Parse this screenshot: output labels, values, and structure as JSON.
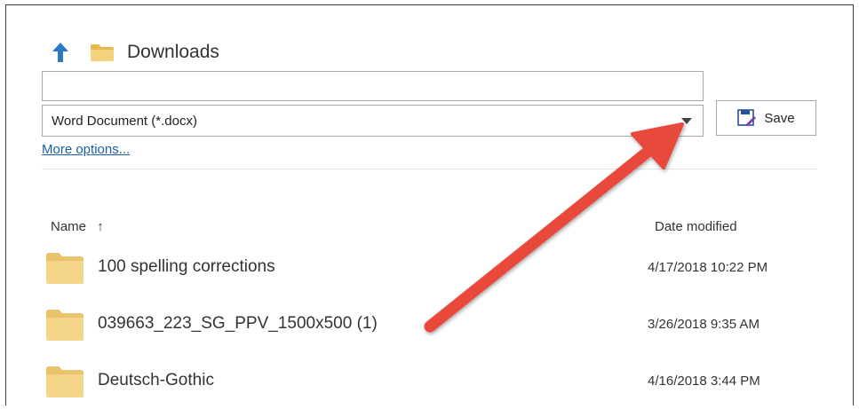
{
  "location": {
    "folder_name": "Downloads",
    "up_icon": "arrow-up-icon",
    "folder_icon": "folder-icon"
  },
  "filename": {
    "value": "",
    "placeholder": ""
  },
  "filetype": {
    "selected": "Word Document (*.docx)"
  },
  "actions": {
    "save_label": "Save",
    "more_options_label": "More options..."
  },
  "columns": {
    "name": "Name",
    "sort_icon": "↑",
    "date_modified": "Date modified"
  },
  "files": [
    {
      "name": "100 spelling corrections",
      "date": "4/17/2018 10:22 PM"
    },
    {
      "name": "039663_223_SG_PPV_1500x500 (1)",
      "date": "3/26/2018 9:35 AM"
    },
    {
      "name": "Deutsch-Gothic",
      "date": "4/16/2018 3:44 PM"
    }
  ],
  "colors": {
    "accent_blue": "#2a78c6",
    "link_blue": "#1a5fa8",
    "folder_yellow": "#f2cf7e",
    "annotation_arrow": "#e8483b"
  }
}
